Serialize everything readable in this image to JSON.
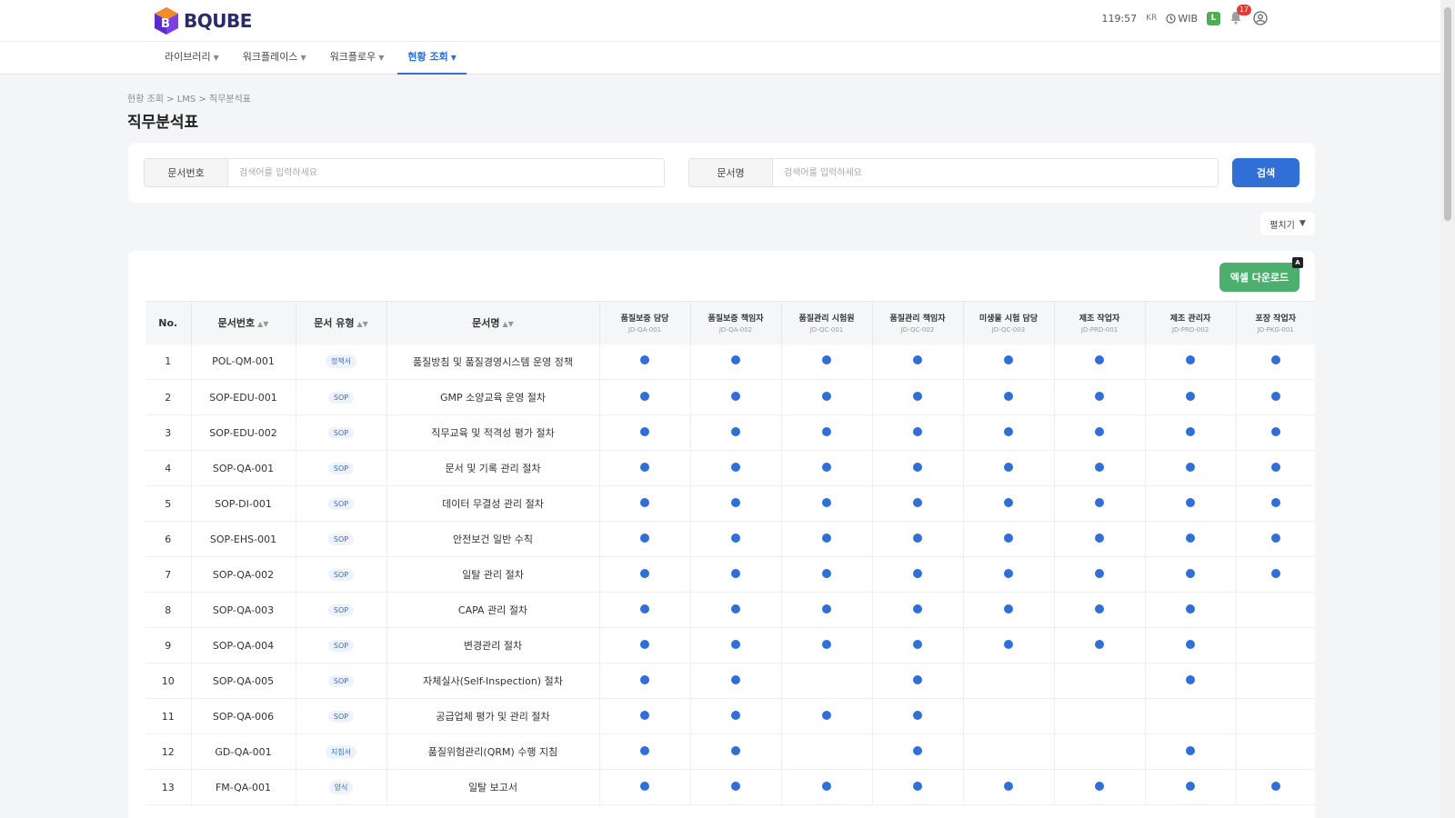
{
  "header": {
    "brand": "BQUBE",
    "timer": "119:57",
    "lang": "KR",
    "timezone": "WIB",
    "user_badge": "L",
    "notification_count": "17"
  },
  "nav": [
    {
      "label": "라이브러리",
      "active": false
    },
    {
      "label": "워크플레이스",
      "active": false
    },
    {
      "label": "워크플로우",
      "active": false
    },
    {
      "label": "현황 조회",
      "active": true
    }
  ],
  "breadcrumb": "현황 조회 > LMS > 직무분석표",
  "page_title": "직무분석표",
  "search": {
    "doc_no_label": "문서번호",
    "doc_no_placeholder": "검색어를 입력하세요",
    "doc_name_label": "문서명",
    "doc_name_placeholder": "검색어를 입력하세요",
    "search_button": "검색"
  },
  "expand_button": "펼치기",
  "excel_button": "엑셀 다운로드",
  "excel_badge": "A",
  "table": {
    "headers": {
      "no": "No.",
      "doc_no": "문서번호",
      "doc_type": "문서 유형",
      "doc_name": "문서명"
    },
    "roles": [
      {
        "name": "품질보증 담당",
        "code": "JD-QA-001"
      },
      {
        "name": "품질보증 책임자",
        "code": "JD-QA-002"
      },
      {
        "name": "품질관리 시험원",
        "code": "JD-QC-001"
      },
      {
        "name": "품질관리 책임자",
        "code": "JD-QC-002"
      },
      {
        "name": "미생물 시험 담당",
        "code": "JD-QC-003"
      },
      {
        "name": "제조 작업자",
        "code": "JD-PRD-001"
      },
      {
        "name": "제조 관리자",
        "code": "JD-PRD-002"
      },
      {
        "name": "포장 작업자",
        "code": "JD-PKG-001"
      }
    ],
    "rows": [
      {
        "no": "1",
        "doc_no": "POL-QM-001",
        "type": "정책서",
        "name": "품질방침 및 품질경영시스템 운영 정책",
        "marks": [
          1,
          1,
          1,
          1,
          1,
          1,
          1,
          1
        ]
      },
      {
        "no": "2",
        "doc_no": "SOP-EDU-001",
        "type": "SOP",
        "name": "GMP 소양교육 운영 절차",
        "marks": [
          1,
          1,
          1,
          1,
          1,
          1,
          1,
          1
        ]
      },
      {
        "no": "3",
        "doc_no": "SOP-EDU-002",
        "type": "SOP",
        "name": "직무교육 및 적격성 평가 절차",
        "marks": [
          1,
          1,
          1,
          1,
          1,
          1,
          1,
          1
        ]
      },
      {
        "no": "4",
        "doc_no": "SOP-QA-001",
        "type": "SOP",
        "name": "문서 및 기록 관리 절차",
        "marks": [
          1,
          1,
          1,
          1,
          1,
          1,
          1,
          1
        ]
      },
      {
        "no": "5",
        "doc_no": "SOP-DI-001",
        "type": "SOP",
        "name": "데이터 무결성 관리 절차",
        "marks": [
          1,
          1,
          1,
          1,
          1,
          1,
          1,
          1
        ]
      },
      {
        "no": "6",
        "doc_no": "SOP-EHS-001",
        "type": "SOP",
        "name": "안전보건 일반 수칙",
        "marks": [
          1,
          1,
          1,
          1,
          1,
          1,
          1,
          1
        ]
      },
      {
        "no": "7",
        "doc_no": "SOP-QA-002",
        "type": "SOP",
        "name": "일탈 관리 절차",
        "marks": [
          1,
          1,
          1,
          1,
          1,
          1,
          1,
          1
        ]
      },
      {
        "no": "8",
        "doc_no": "SOP-QA-003",
        "type": "SOP",
        "name": "CAPA 관리 절차",
        "marks": [
          1,
          1,
          1,
          1,
          1,
          1,
          1,
          0
        ]
      },
      {
        "no": "9",
        "doc_no": "SOP-QA-004",
        "type": "SOP",
        "name": "변경관리 절차",
        "marks": [
          1,
          1,
          1,
          1,
          1,
          1,
          1,
          0
        ]
      },
      {
        "no": "10",
        "doc_no": "SOP-QA-005",
        "type": "SOP",
        "name": "자체실사(Self-Inspection) 절차",
        "marks": [
          1,
          1,
          0,
          1,
          0,
          0,
          1,
          0
        ]
      },
      {
        "no": "11",
        "doc_no": "SOP-QA-006",
        "type": "SOP",
        "name": "공급업체 평가 및 관리 절차",
        "marks": [
          1,
          1,
          1,
          1,
          0,
          0,
          0,
          0
        ]
      },
      {
        "no": "12",
        "doc_no": "GD-QA-001",
        "type": "지침서",
        "name": "품질위험관리(QRM) 수행 지침",
        "marks": [
          1,
          1,
          0,
          1,
          0,
          0,
          1,
          0
        ]
      },
      {
        "no": "13",
        "doc_no": "FM-QA-001",
        "type": "양식",
        "name": "일탈 보고서",
        "marks": [
          1,
          1,
          1,
          1,
          1,
          1,
          1,
          1
        ]
      }
    ]
  }
}
